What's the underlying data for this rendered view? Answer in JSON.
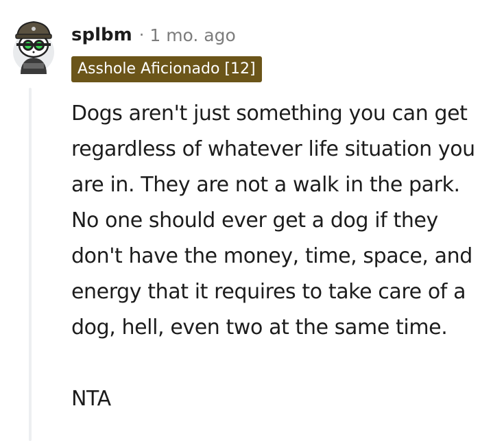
{
  "comment": {
    "username": "splbm",
    "separator": "·",
    "timestamp": "1 mo. ago",
    "flair": "Asshole Aficionado [12]",
    "flair_color": "#6b5519",
    "avatar_icon": "snoo-avatar-icon",
    "paragraphs": [
      "Dogs aren't just something you can get regardless of whatever life situation you are in. They are not a walk in the park. No one should ever get a dog if they don't have the money, time, space, and energy that it requires to take care of a dog, hell, even two at the same time.",
      "NTA"
    ]
  }
}
